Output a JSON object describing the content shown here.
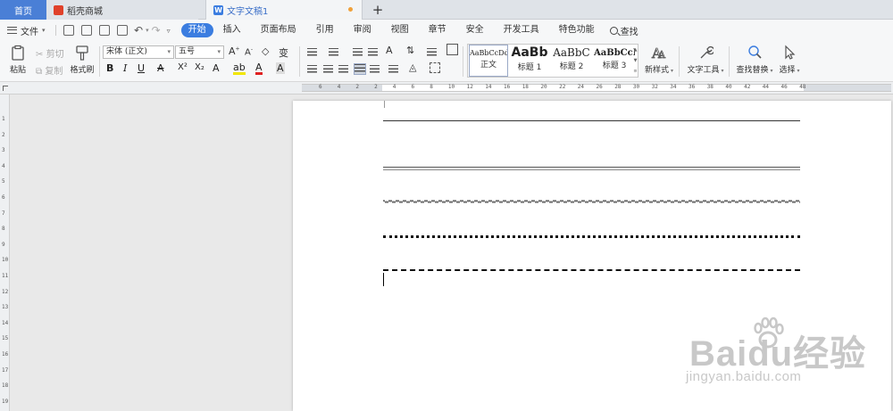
{
  "tabs": {
    "home": "首页",
    "store": "稻壳商城",
    "document": "文字文稿1",
    "add": "+"
  },
  "menu": {
    "file": "文件",
    "items": [
      "开始",
      "插入",
      "页面布局",
      "引用",
      "审阅",
      "视图",
      "章节",
      "安全",
      "开发工具",
      "特色功能"
    ],
    "active_index": 0,
    "search": "查找"
  },
  "ribbon": {
    "paste": "粘贴",
    "cut": "剪切",
    "copy": "复制",
    "format_painter": "格式刷",
    "font_name": "宋体 (正文)",
    "font_size": "五号",
    "bold": "B",
    "italic": "I",
    "underline": "U",
    "strikethrough": "A",
    "superscript": "X²",
    "subscript": "X₂",
    "styles": [
      {
        "preview": "AaBbCcDd",
        "name": "正文"
      },
      {
        "preview": "AaBb",
        "name": "标题 1"
      },
      {
        "preview": "AaBbC",
        "name": "标题 2"
      },
      {
        "preview": "AaBbCcI",
        "name": "标题 3"
      }
    ],
    "new_style": "新样式",
    "text_tools": "文字工具",
    "find_replace": "查找替换",
    "select": "选择"
  },
  "ruler": {
    "h_ticks": [
      "6",
      "4",
      "2",
      "2",
      "4",
      "6",
      "8",
      "10",
      "12",
      "14",
      "16",
      "18",
      "20",
      "22",
      "24",
      "26",
      "28",
      "30",
      "32",
      "34",
      "36",
      "38",
      "40",
      "42",
      "44",
      "46",
      "48"
    ],
    "v_ticks": [
      "1",
      "2",
      "3",
      "4",
      "5",
      "6",
      "7",
      "8",
      "9",
      "10",
      "11",
      "12",
      "13",
      "14",
      "15",
      "16",
      "17",
      "18",
      "19"
    ]
  },
  "document": {
    "line_styles": [
      "thin",
      "double",
      "wavy",
      "dotted",
      "dashed"
    ]
  },
  "watermark": {
    "brand": "Baidu经验",
    "url": "jingyan.baidu.com"
  },
  "colors": {
    "accent": "#3b7de0",
    "home_tab": "#4a7fd6",
    "page": "#ffffff",
    "workspace": "#e9e9e9"
  }
}
